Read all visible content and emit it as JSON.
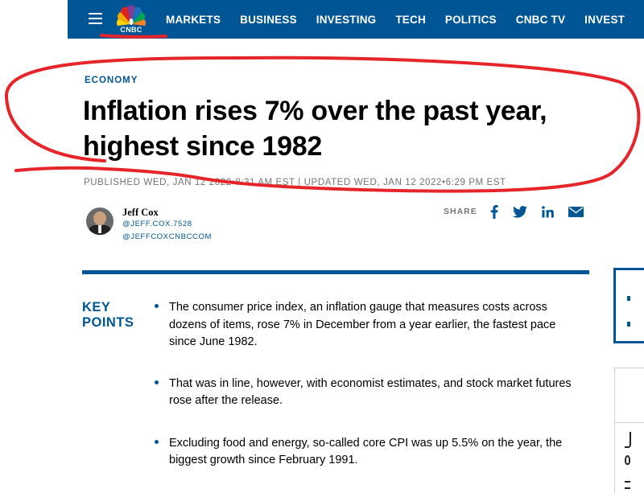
{
  "nav": {
    "logo_text": "CNBC",
    "links": [
      "MARKETS",
      "BUSINESS",
      "INVESTING",
      "TECH",
      "POLITICS",
      "CNBC TV",
      "INVEST"
    ]
  },
  "article": {
    "section": "ECONOMY",
    "headline": "Inflation rises 7% over the past year, highest since 1982",
    "published": "PUBLISHED WED, JAN 12 2022•8:31 AM EST | UPDATED WED, JAN 12 2022•6:29 PM EST"
  },
  "author": {
    "name": "Jeff Cox",
    "handle1": "@JEFF.COX.7528",
    "handle2": "@JEFFCOXCNBCCOM"
  },
  "share": {
    "label": "SHARE",
    "icons": [
      "facebook-icon",
      "twitter-icon",
      "linkedin-icon",
      "email-icon"
    ]
  },
  "key_points": {
    "title": "KEY POINTS",
    "items": [
      "The consumer price index, an inflation gauge that measures costs across dozens of items, rose 7% in December from a year earlier, the fastest pace since June 1982.",
      "That was in line, however, with economist estimates, and stock market futures rose after the release.",
      "Excluding food and energy, so-called core CPI was up 5.5% on the year, the biggest growth since February 1991."
    ]
  },
  "colors": {
    "brand_blue": "#005594",
    "annotation_red": "#e5252a",
    "meta_gray": "#747474"
  }
}
